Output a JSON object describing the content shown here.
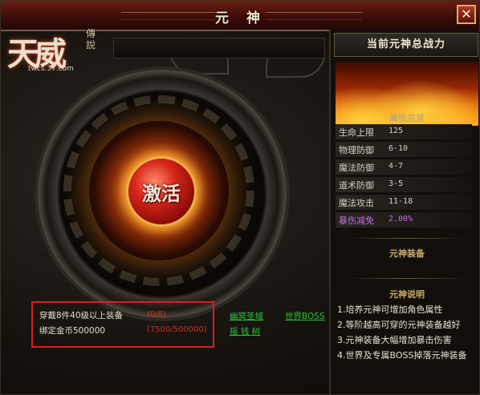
{
  "window": {
    "title": "元 神",
    "close_label": "✕"
  },
  "logo": {
    "main": "天威",
    "side": "傳說",
    "url": "twcs.37.com"
  },
  "orb": {
    "label": "激活"
  },
  "requirements": [
    {
      "label": "穿戴8件40级以上装备",
      "value": "(0/8)"
    },
    {
      "label": "绑定金币500000",
      "value": "(7500/500000)"
    }
  ],
  "links": {
    "netherworld": "幽冥圣域",
    "world_boss": "世界BOSS",
    "money_tree": "摇 钱 树"
  },
  "panel": {
    "header": "当前元神总战力",
    "attributes_title": "属性总览",
    "attributes": [
      {
        "label": "生命上限",
        "value": "125"
      },
      {
        "label": "物理防御",
        "value": "6-10"
      },
      {
        "label": "魔法防御",
        "value": "4-7"
      },
      {
        "label": "道术防御",
        "value": "3-5"
      },
      {
        "label": "魔法攻击",
        "value": "11-18"
      },
      {
        "label": "暴伤减免",
        "value": "2.00%"
      }
    ],
    "equipment_title": "元神装备",
    "description_title": "元神说明",
    "description": [
      "1.培养元神可增加角色属性",
      "2.等阶越高可穿的元神装备越好",
      "3.元神装备大幅增加暴击伤害",
      "4.世界及专属BOSS掉落元神装备"
    ]
  },
  "colors": {
    "title_bar": "#6b1d12",
    "requirement_border": "#d82020",
    "requirement_value": "#d52c22",
    "link_green": "#2ac23a",
    "crit_reduction_purple": "#c070e6"
  }
}
